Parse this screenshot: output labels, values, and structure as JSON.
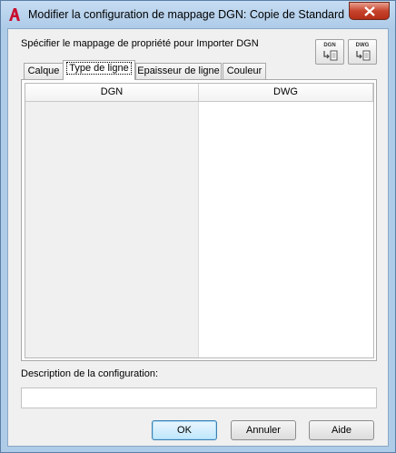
{
  "window": {
    "title": "Modifier la configuration de mappage DGN: Copie de Standard",
    "app_icon": "autocad-a-icon",
    "close_icon": "close-icon"
  },
  "dialog": {
    "spec_label": "Spécifier le mappage de propriété pour Importer DGN",
    "corner_buttons": [
      {
        "label": "DGN",
        "icon": "import-dgn-icon"
      },
      {
        "label": "DWG",
        "icon": "import-dwg-icon"
      }
    ],
    "tabs": [
      {
        "label": "Calque",
        "active": false
      },
      {
        "label": "Type de ligne",
        "active": true
      },
      {
        "label": "Epaisseur de ligne",
        "active": false
      },
      {
        "label": "Couleur",
        "active": false
      }
    ],
    "grid": {
      "headers": [
        "DGN",
        "DWG"
      ],
      "rows": [
        [
          "",
          ""
        ],
        [
          "",
          ""
        ],
        [
          "",
          ""
        ],
        [
          "",
          ""
        ],
        [
          "",
          ""
        ],
        [
          "",
          ""
        ],
        [
          "",
          ""
        ],
        [
          "",
          ""
        ],
        [
          "",
          ""
        ],
        [
          "",
          ""
        ],
        [
          "",
          ""
        ],
        [
          "",
          ""
        ],
        [
          "",
          ""
        ]
      ]
    },
    "desc_label": "Description de la configuration:",
    "desc_value": "",
    "buttons": {
      "ok": "OK",
      "cancel": "Annuler",
      "help": "Aide"
    }
  }
}
